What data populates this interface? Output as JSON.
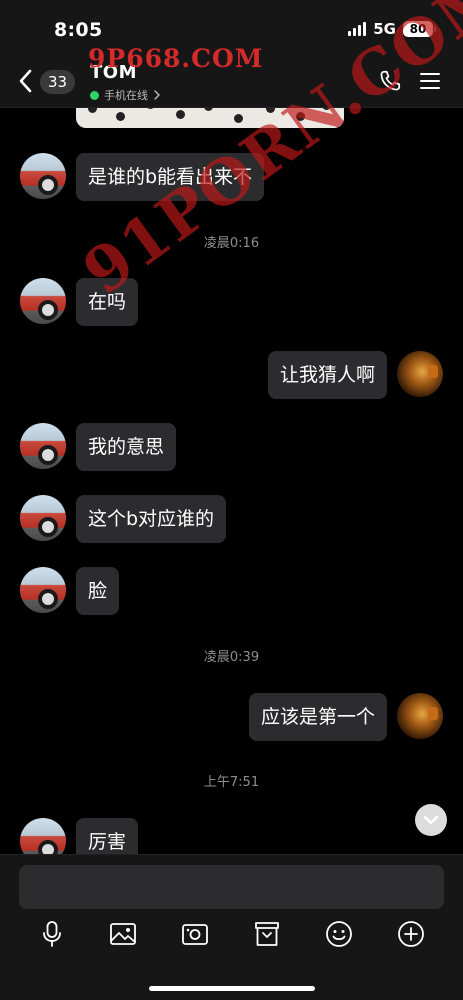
{
  "status_bar": {
    "time": "8:05",
    "network": "5G",
    "battery": "80"
  },
  "header": {
    "unread_count": "33",
    "contact_name": "TOM",
    "online_status": "手机在线",
    "online_color": "#2fd36c",
    "icons": [
      "back-chevron-icon",
      "phone-icon",
      "menu-icon"
    ]
  },
  "watermark": {
    "top_text": "9P668.COM",
    "diagonal_text": "91PORN.COM"
  },
  "messages": {
    "m1": "是谁的b能看出来不",
    "t1": "凌晨0:16",
    "m2": "在吗",
    "m3": "让我猜人啊",
    "m4": "我的意思",
    "m5": "这个b对应谁的",
    "m6": "脸",
    "t2": "凌晨0:39",
    "m7": "应该是第一个",
    "t3": "上午7:51",
    "m8": "厉害"
  },
  "composer": {
    "input_value": "",
    "tools": [
      "microphone-icon",
      "image-icon",
      "camera-icon",
      "folder-icon",
      "emoji-icon",
      "plus-icon"
    ]
  },
  "colors": {
    "bubble_bg": "#2c2c2e",
    "bar_bg": "#161616",
    "chat_bg": "#000000"
  }
}
